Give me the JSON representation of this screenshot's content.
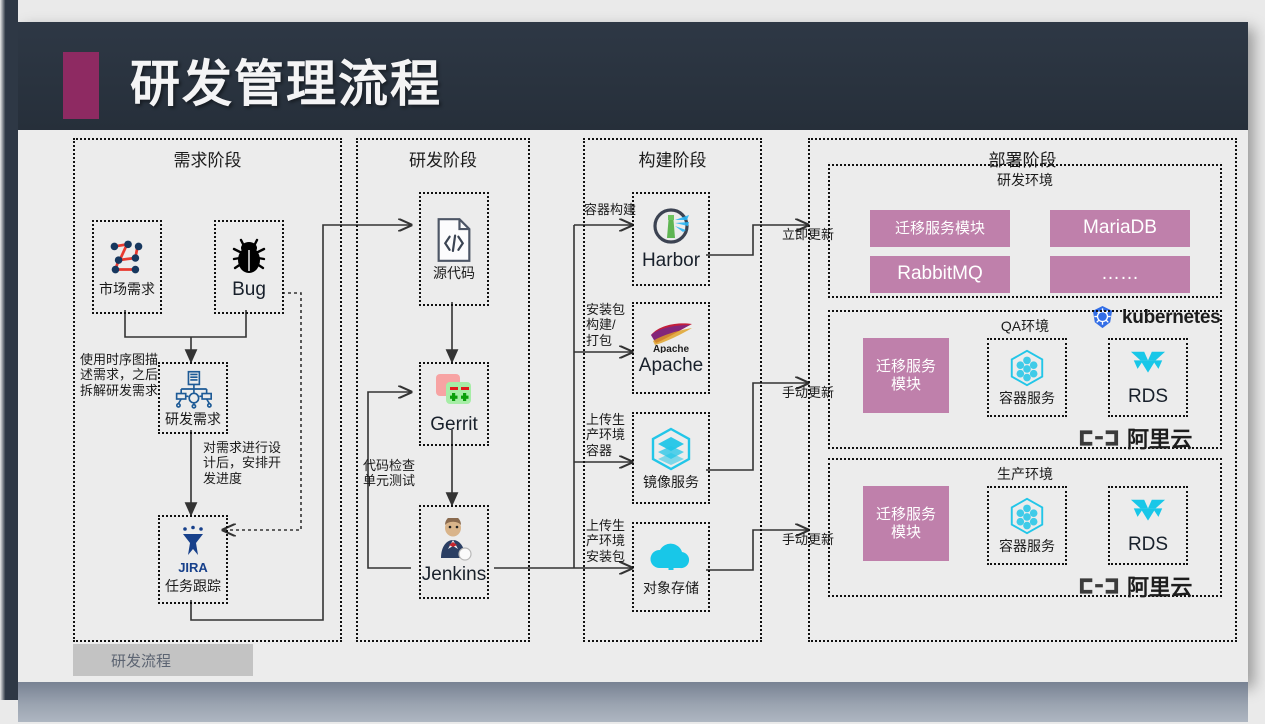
{
  "slide": {
    "title": "研发管理流程",
    "tab_label": "研发流程",
    "accent_color": "#8e2a62",
    "header_color": "#2e3845",
    "purple_color": "#bf80ab"
  },
  "phases": [
    {
      "id": "requirement",
      "title": "需求阶段"
    },
    {
      "id": "develop",
      "title": "研发阶段"
    },
    {
      "id": "build",
      "title": "构建阶段"
    },
    {
      "id": "deploy",
      "title": "部署阶段"
    }
  ],
  "requirement": {
    "nodes": [
      {
        "id": "market",
        "label": "市场需求",
        "icon": "network-graph-icon"
      },
      {
        "id": "bug",
        "label": "Bug",
        "icon": "bug-icon"
      },
      {
        "id": "rdreq",
        "label": "研发需求",
        "icon": "rd-requirement-icon"
      },
      {
        "id": "jira",
        "label": "任务跟踪",
        "brand": "JIRA",
        "icon": "jira-icon"
      }
    ],
    "edge_labels": [
      {
        "id": "seq-desc",
        "text": "使用时序图描\n述需求，之后\n拆解研发需求"
      },
      {
        "id": "design",
        "text": "对需求进行设\n计后，安排开\n发进度"
      }
    ]
  },
  "develop": {
    "nodes": [
      {
        "id": "source",
        "label": "源代码",
        "icon": "source-code-icon"
      },
      {
        "id": "gerrit",
        "label": "Gerrit",
        "icon": "gerrit-icon"
      },
      {
        "id": "jenkins",
        "label": "Jenkins",
        "icon": "jenkins-icon"
      }
    ],
    "edge_labels": [
      {
        "id": "review",
        "text": "代码检查\n单元测试"
      }
    ]
  },
  "build": {
    "nodes": [
      {
        "id": "harbor",
        "label": "Harbor",
        "icon": "harbor-icon"
      },
      {
        "id": "apache",
        "label": "Apache",
        "icon": "apache-icon"
      },
      {
        "id": "image",
        "label": "镜像服务",
        "icon": "image-service-icon"
      },
      {
        "id": "oss",
        "label": "对象存储",
        "icon": "object-storage-icon"
      }
    ],
    "edge_labels": [
      {
        "id": "container-build",
        "text": "容器构建"
      },
      {
        "id": "package-build",
        "text": "安装包\n构建/\n打包"
      },
      {
        "id": "upload-container",
        "text": "上传生\n产环境\n容器"
      },
      {
        "id": "upload-package",
        "text": "上传生\n产环境\n安装包"
      }
    ]
  },
  "deploy": {
    "environments": [
      {
        "id": "dev-env",
        "title": "研发环境",
        "update_label": "立即更新",
        "boxes": [
          "迁移服务模块",
          "MariaDB",
          "RabbitMQ",
          "……"
        ],
        "brand": "kubernetes",
        "brand_icon": "kubernetes-icon"
      },
      {
        "id": "qa-env",
        "title": "QA环境",
        "update_label": "手动更新",
        "service_box": "迁移服务\n模块",
        "nodes": [
          {
            "id": "qa-container",
            "label": "容器服务",
            "icon": "container-service-icon"
          },
          {
            "id": "qa-rds",
            "label": "RDS",
            "icon": "rds-icon"
          }
        ],
        "brand": "阿里云",
        "brand_icon": "aliyun-icon"
      },
      {
        "id": "prod-env",
        "title": "生产环境",
        "update_label": "手动更新",
        "service_box": "迁移服务\n模块",
        "nodes": [
          {
            "id": "prod-container",
            "label": "容器服务",
            "icon": "container-service-icon"
          },
          {
            "id": "prod-rds",
            "label": "RDS",
            "icon": "rds-icon"
          }
        ],
        "brand": "阿里云",
        "brand_icon": "aliyun-icon"
      }
    ]
  }
}
